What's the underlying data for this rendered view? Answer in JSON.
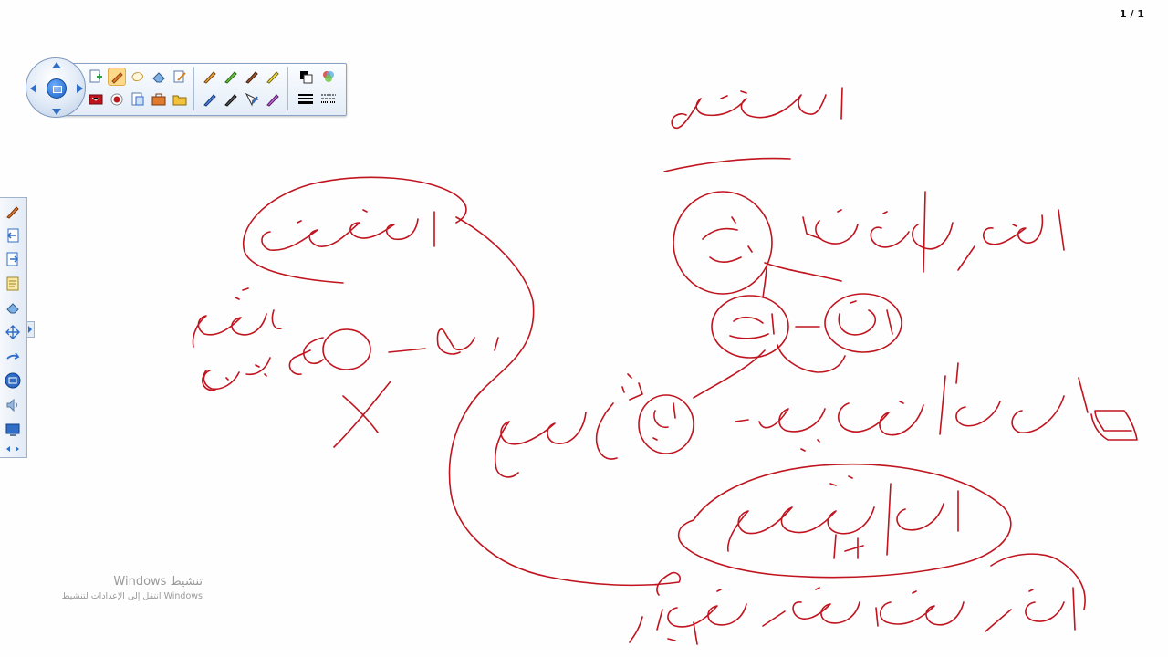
{
  "page_counter": "1 / 1",
  "floating_toolbar": {
    "row1": [
      "new-page-icon",
      "pen-icon",
      "shape-icon",
      "eraser-icon",
      "edit-page-icon",
      "pencil-orange-icon",
      "marker-green-icon",
      "brush-icon",
      "highlighter-yellow-icon",
      "color-picker-icon",
      "layers-icon"
    ],
    "row2": [
      "screen-capture-icon",
      "record-icon",
      "document-icon",
      "toolbox-icon",
      "folder-icon",
      "pen-blue-icon",
      "marker-dark-icon",
      "selection-pen-icon",
      "magic-pen-icon",
      "line-width-icon",
      "line-style-icon"
    ]
  },
  "side_toolbar": {
    "items": [
      "pen-icon",
      "previous-page-icon",
      "next-page-icon",
      "notes-icon",
      "eraser-icon",
      "move-icon",
      "undo-arrow-icon",
      "main-menu-icon",
      "volume-icon",
      "display-icon",
      "expand-icon"
    ]
  },
  "watermark": {
    "title": "Windows تنشيط",
    "subtitle": "انتقل إلى الإعدادات لتنشيط Windows"
  },
  "colors": {
    "ink": "#c0141f",
    "toolbar_border": "#8aa3c4",
    "accent": "#2f6dc6"
  }
}
